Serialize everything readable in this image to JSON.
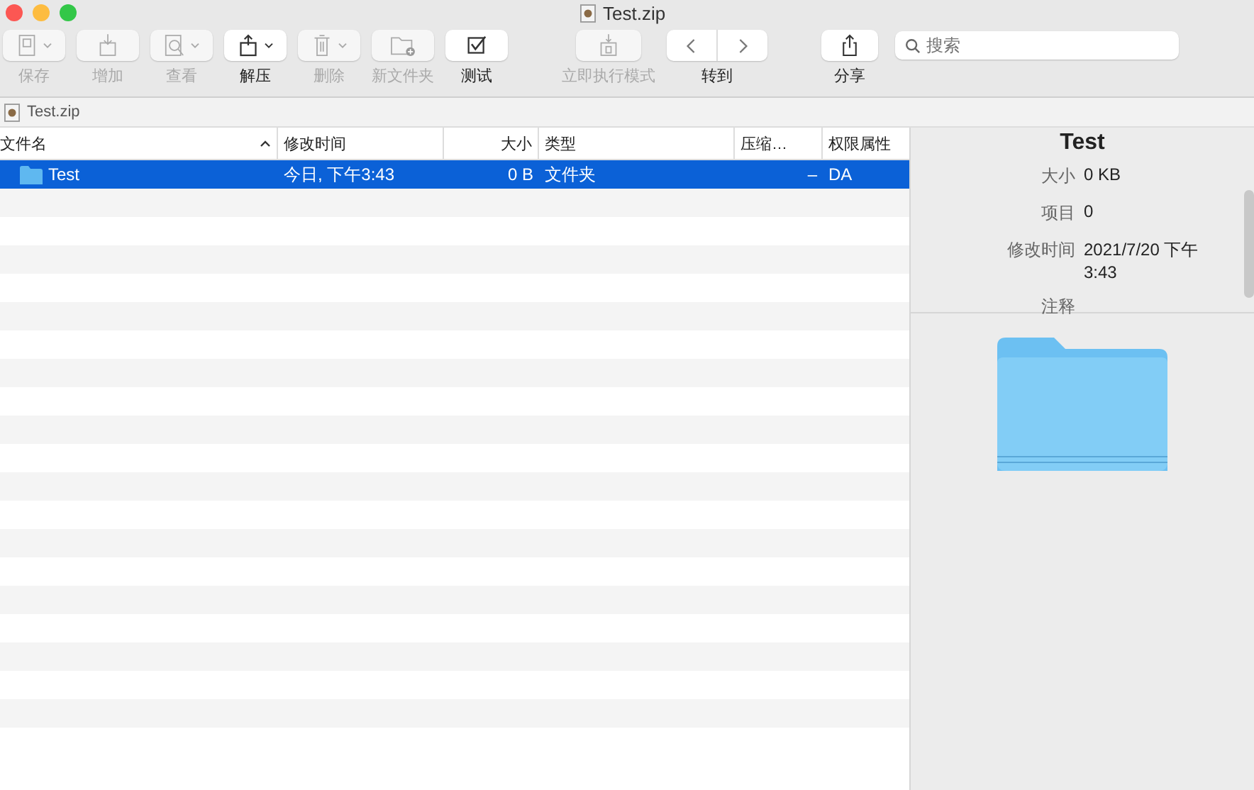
{
  "window": {
    "title": "Test.zip"
  },
  "toolbar": [
    {
      "kind": "save",
      "label": "保存",
      "disabled": true,
      "dropdown": true
    },
    {
      "kind": "add",
      "label": "增加",
      "disabled": true,
      "dropdown": false
    },
    {
      "kind": "view",
      "label": "查看",
      "disabled": true,
      "dropdown": true
    },
    {
      "kind": "extract",
      "label": "解压",
      "disabled": false,
      "dropdown": true
    },
    {
      "kind": "delete",
      "label": "删除",
      "disabled": true,
      "dropdown": true
    },
    {
      "kind": "newfolder",
      "label": "新文件夹",
      "disabled": true,
      "dropdown": false
    },
    {
      "kind": "test",
      "label": "测试",
      "disabled": false,
      "dropdown": false
    },
    {
      "kind": "instant",
      "label": "立即执行模式",
      "disabled": true,
      "dropdown": false
    },
    {
      "kind": "nav",
      "label": "转到"
    },
    {
      "kind": "share",
      "label": "分享",
      "disabled": false,
      "dropdown": false
    }
  ],
  "search": {
    "placeholder": "搜索"
  },
  "path_bar": {
    "label": "Test.zip"
  },
  "table": {
    "columns": [
      {
        "label": "文件名",
        "sorted": true
      },
      {
        "label": "修改时间",
        "sorted": false
      },
      {
        "label": "大小",
        "sorted": false
      },
      {
        "label": "类型",
        "sorted": false
      },
      {
        "label": "压缩…",
        "sorted": false
      },
      {
        "label": "权限属性",
        "sorted": false
      }
    ],
    "rows": [
      {
        "name": "Test",
        "modified": "今日, 下午3:43",
        "size": "0 B",
        "type": "文件夹",
        "ratio": "–",
        "attributes": "DA",
        "selected": true
      }
    ]
  },
  "inspector": {
    "title": "Test",
    "properties": [
      {
        "label": "大小",
        "value": "0 KB"
      },
      {
        "label": "项目",
        "value": "0"
      },
      {
        "label": "修改时间",
        "value": "2021/7/20 下午 3:43"
      },
      {
        "label": "注释"
      }
    ]
  }
}
